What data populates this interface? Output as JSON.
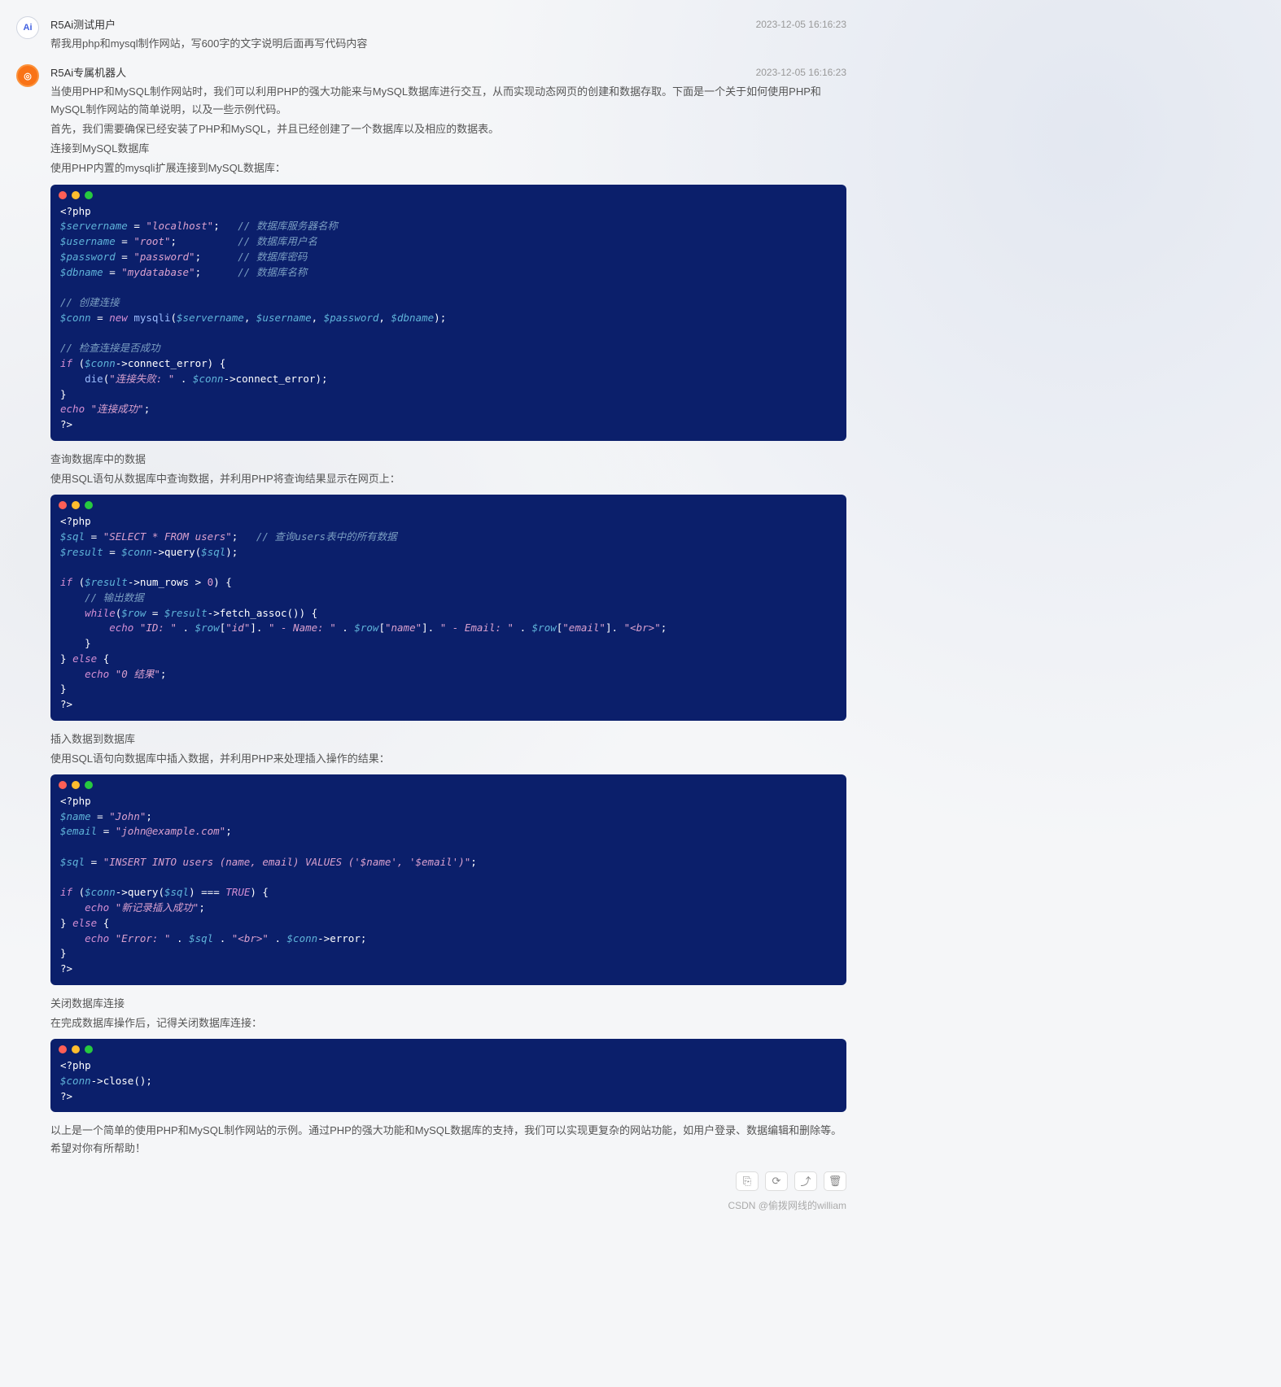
{
  "user_msg": {
    "name": "R5Ai测试用户",
    "avatar_text": "Ai",
    "time": "2023-12-05 16:16:23",
    "text": "帮我用php和mysql制作网站，写600字的文字说明后面再写代码内容"
  },
  "bot_msg": {
    "name": "R5Ai专属机器人",
    "avatar_text": "◎",
    "time": "2023-12-05 16:16:23",
    "intro1": "当使用PHP和MySQL制作网站时，我们可以利用PHP的强大功能来与MySQL数据库进行交互，从而实现动态网页的创建和数据存取。下面是一个关于如何使用PHP和MySQL制作网站的简单说明，以及一些示例代码。",
    "intro2": "首先，我们需要确保已经安装了PHP和MySQL，并且已经创建了一个数据库以及相应的数据表。",
    "sec1_h": "连接到MySQL数据库",
    "sec1_p": "使用PHP内置的mysqli扩展连接到MySQL数据库：",
    "sec2_h": "查询数据库中的数据",
    "sec2_p": "使用SQL语句从数据库中查询数据，并利用PHP将查询结果显示在网页上：",
    "sec3_h": "插入数据到数据库",
    "sec3_p": "使用SQL语句向数据库中插入数据，并利用PHP来处理插入操作的结果：",
    "sec4_h": "关闭数据库连接",
    "sec4_p": "在完成数据库操作后，记得关闭数据库连接：",
    "outro": "以上是一个简单的使用PHP和MySQL制作网站的示例。通过PHP的强大功能和MySQL数据库的支持，我们可以实现更复杂的网站功能，如用户登录、数据编辑和删除等。希望对你有所帮助！"
  },
  "code1": {
    "open": "<?php",
    "l1a": "$servername",
    "l1b": "=",
    "l1c": "\"localhost\"",
    "l1d": ";",
    "l1e": "// 数据库服务器名称",
    "l2a": "$username",
    "l2c": "\"root\"",
    "l2e": "// 数据库用户名",
    "l3a": "$password",
    "l3c": "\"password\"",
    "l3e": "// 数据库密码",
    "l4a": "$dbname",
    "l4c": "\"mydatabase\"",
    "l4e": "// 数据库名称",
    "c1": "// 创建连接",
    "l5a": "$conn",
    "l5b": "new",
    "l5c": "mysqli",
    "l5d": "$servername",
    "l5e": "$username",
    "l5f": "$password",
    "l5g": "$dbname",
    "c2": "// 检查连接是否成功",
    "l6a": "if",
    "l6b": "$conn",
    "l6c": "->connect_error",
    "l7a": "die",
    "l7b": "\"连接失败: \"",
    "l7c": "$conn",
    "l7d": "->connect_error",
    "l8a": "echo",
    "l8b": "\"连接成功\"",
    "close": "?>"
  },
  "code2": {
    "open": "<?php",
    "l1a": "$sql",
    "l1b": "\"SELECT * FROM users\"",
    "l1c": "// 查询users表中的所有数据",
    "l2a": "$result",
    "l2b": "$conn",
    "l2c": "->query(",
    "l2d": "$sql",
    "l3a": "if",
    "l3b": "$result",
    "l3c": "->num_rows",
    "l3d": "0",
    "c1": "// 输出数据",
    "l4a": "while",
    "l4b": "$row",
    "l4c": "$result",
    "l4d": "->fetch_assoc()",
    "l5a": "echo",
    "l5b": "\"ID: \"",
    "l5c": "$row",
    "l5d": "\"id\"",
    "l5e": "\" - Name: \"",
    "l5f": "\"name\"",
    "l5g": "\" - Email: \"",
    "l5h": "\"email\"",
    "l5i": "\"<br>\"",
    "l6a": "else",
    "l7a": "echo",
    "l7b": "\"0 结果\"",
    "close": "?>"
  },
  "code3": {
    "open": "<?php",
    "l1a": "$name",
    "l1b": "\"John\"",
    "l2a": "$email",
    "l2b": "\"john@example.com\"",
    "l3a": "$sql",
    "l3b": "\"INSERT INTO users (name, email) VALUES ('$name', '$email')\"",
    "l4a": "if",
    "l4b": "$conn",
    "l4c": "->query(",
    "l4d": "$sql",
    "l4e": "TRUE",
    "l5a": "echo",
    "l5b": "\"新记录插入成功\"",
    "l6a": "else",
    "l7a": "echo",
    "l7b": "\"Error: \"",
    "l7c": "$sql",
    "l7d": "\"<br>\"",
    "l7e": "$conn",
    "l7f": "->error",
    "close": "?>"
  },
  "code4": {
    "open": "<?php",
    "l1a": "$conn",
    "l1b": "->close()",
    "close": "?>"
  },
  "actions": {
    "copy": "⎘",
    "refresh": "⟳",
    "share": "⤴",
    "delete": "🗑"
  },
  "watermark": "CSDN @偷拨网线的william"
}
